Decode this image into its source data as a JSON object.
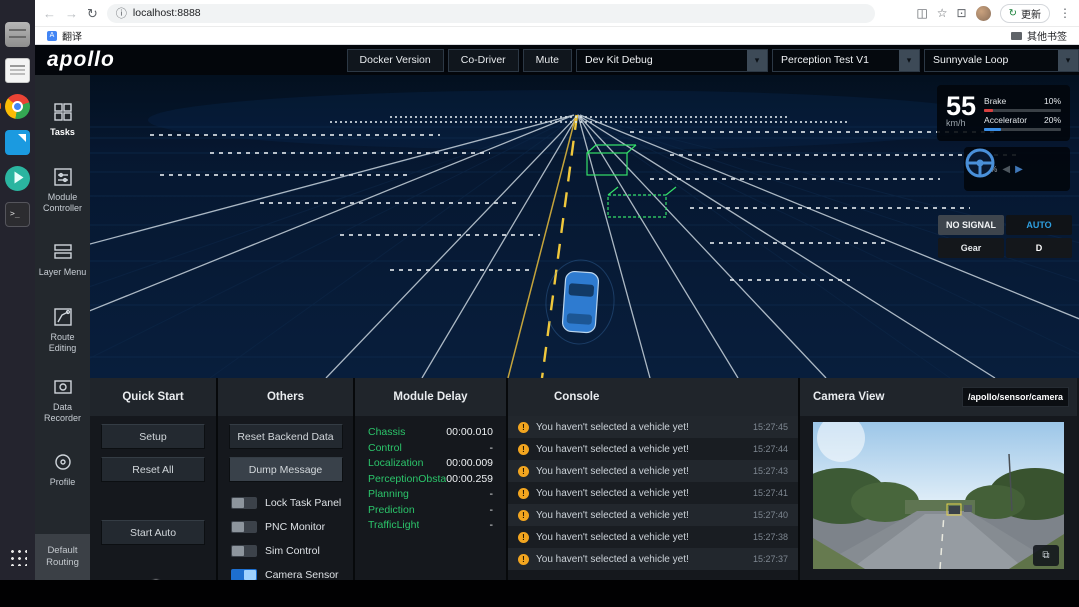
{
  "colors": {
    "accent": "#30a5ff",
    "module_green": "#2bc46a",
    "warning": "#f2a51f",
    "auto_blue": "#2e9fe0"
  },
  "browser": {
    "url": "localhost:8888",
    "update_label": "更新",
    "bookmarks": {
      "translate": "翻译",
      "other_bookmarks": "其他书签"
    }
  },
  "header": {
    "logo": "apollo",
    "buttons": [
      {
        "label": "Docker Version"
      },
      {
        "label": "Co-Driver"
      },
      {
        "label": "Mute"
      }
    ],
    "dropdowns": [
      {
        "value": "Dev Kit Debug"
      },
      {
        "value": "Perception Test V1"
      },
      {
        "value": "Sunnyvale Loop"
      }
    ]
  },
  "sidebar": {
    "items": [
      {
        "label": "Tasks",
        "active": true
      },
      {
        "label": "Module Controller",
        "active": false
      },
      {
        "label": "Layer Menu",
        "active": false
      },
      {
        "label": "Route Editing",
        "active": false
      },
      {
        "label": "Data Recorder",
        "active": false
      },
      {
        "label": "Profile",
        "active": false
      },
      {
        "label": "Default Routing",
        "active": false
      }
    ]
  },
  "hud": {
    "speed_value": "55",
    "speed_unit": "km/h",
    "brake_label": "Brake",
    "brake_value": "10%",
    "accelerator_label": "Accelerator",
    "accelerator_value": "20%",
    "steering_value": "0",
    "steering_unit": "%",
    "signal_label": "NO SIGNAL",
    "drive_mode": "AUTO",
    "gear_label": "Gear",
    "gear_value": "D"
  },
  "panels": {
    "quick_start": {
      "title": "Quick Start",
      "buttons": [
        {
          "label": "Setup"
        },
        {
          "label": "Reset All"
        },
        {
          "label": "Start Auto"
        }
      ]
    },
    "others": {
      "title": "Others",
      "buttons": [
        {
          "label": "Reset Backend Data"
        },
        {
          "label": "Dump Message"
        }
      ],
      "toggles": [
        {
          "label": "Lock Task Panel",
          "on": false
        },
        {
          "label": "PNC Monitor",
          "on": false
        },
        {
          "label": "Sim Control",
          "on": false
        },
        {
          "label": "Camera Sensor",
          "on": true
        }
      ]
    },
    "module_delay": {
      "title": "Module Delay",
      "rows": [
        {
          "name": "Chassis",
          "value": "00:00.010"
        },
        {
          "name": "Control",
          "value": "-"
        },
        {
          "name": "Localization",
          "value": "00:00.009"
        },
        {
          "name": "PerceptionObstacl",
          "value": "00:00.259"
        },
        {
          "name": "Planning",
          "value": "-"
        },
        {
          "name": "Prediction",
          "value": "-"
        },
        {
          "name": "TrafficLight",
          "value": "-"
        }
      ]
    },
    "console": {
      "title": "Console",
      "messages": [
        {
          "text": "You haven't selected a vehicle yet!",
          "time": "15:27:45"
        },
        {
          "text": "You haven't selected a vehicle yet!",
          "time": "15:27:44"
        },
        {
          "text": "You haven't selected a vehicle yet!",
          "time": "15:27:43"
        },
        {
          "text": "You haven't selected a vehicle yet!",
          "time": "15:27:41"
        },
        {
          "text": "You haven't selected a vehicle yet!",
          "time": "15:27:40"
        },
        {
          "text": "You haven't selected a vehicle yet!",
          "time": "15:27:38"
        },
        {
          "text": "You haven't selected a vehicle yet!",
          "time": "15:27:37"
        }
      ]
    },
    "camera": {
      "title": "Camera View",
      "topic": "/apollo/sensor/camera"
    }
  }
}
